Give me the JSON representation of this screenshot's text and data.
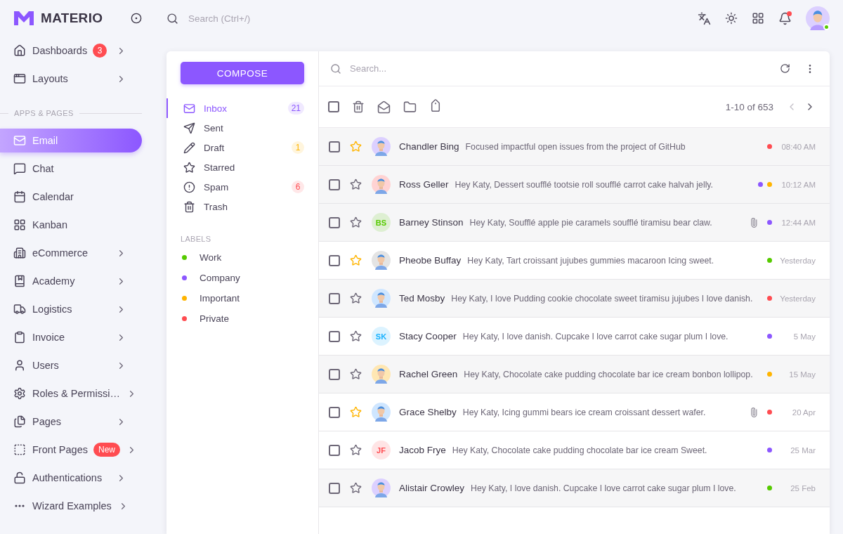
{
  "brand": {
    "name": "MATERIO"
  },
  "topbar": {
    "search": {
      "placeholder": "Search (Ctrl+/)"
    },
    "notifications": {
      "unread": true
    },
    "user": {
      "online": true
    }
  },
  "nav": [
    {
      "kind": "item",
      "label": "Dashboards",
      "badge": {
        "kind": "count",
        "text": "3"
      },
      "expandable": true,
      "selected": false
    },
    {
      "kind": "item",
      "label": "Layouts",
      "expandable": true,
      "selected": false
    },
    {
      "kind": "section",
      "label": "APPS & PAGES"
    },
    {
      "kind": "item",
      "label": "Email",
      "expandable": false,
      "selected": true
    },
    {
      "kind": "item",
      "label": "Chat",
      "expandable": false,
      "selected": false
    },
    {
      "kind": "item",
      "label": "Calendar",
      "expandable": false,
      "selected": false
    },
    {
      "kind": "item",
      "label": "Kanban",
      "expandable": false,
      "selected": false
    },
    {
      "kind": "item",
      "label": "eCommerce",
      "expandable": true,
      "selected": false
    },
    {
      "kind": "item",
      "label": "Academy",
      "expandable": true,
      "selected": false
    },
    {
      "kind": "item",
      "label": "Logistics",
      "expandable": true,
      "selected": false
    },
    {
      "kind": "item",
      "label": "Invoice",
      "expandable": true,
      "selected": false
    },
    {
      "kind": "item",
      "label": "Users",
      "expandable": true,
      "selected": false
    },
    {
      "kind": "item",
      "label": "Roles & Permissi…",
      "expandable": true,
      "selected": false
    },
    {
      "kind": "item",
      "label": "Pages",
      "expandable": true,
      "selected": false
    },
    {
      "kind": "item",
      "label": "Front Pages",
      "badge": {
        "kind": "pill",
        "text": "New"
      },
      "expandable": true,
      "selected": false
    },
    {
      "kind": "item",
      "label": "Authentications",
      "expandable": true,
      "selected": false
    },
    {
      "kind": "item",
      "label": "Wizard Examples",
      "expandable": true,
      "selected": false
    }
  ],
  "compose": {
    "label": "COMPOSE"
  },
  "folders": [
    {
      "label": "Inbox",
      "count": "21",
      "color": "#8c57ff",
      "selected": true
    },
    {
      "label": "Sent",
      "selected": false
    },
    {
      "label": "Draft",
      "count": "1",
      "color": "#ffb400",
      "selected": false
    },
    {
      "label": "Starred",
      "selected": false
    },
    {
      "label": "Spam",
      "count": "6",
      "color": "#ff4c51",
      "selected": false
    },
    {
      "label": "Trash",
      "selected": false
    }
  ],
  "labels_title": "LABELS",
  "labels": [
    {
      "label": "Work",
      "color": "#56ca00"
    },
    {
      "label": "Company",
      "color": "#8c57ff"
    },
    {
      "label": "Important",
      "color": "#ffb400"
    },
    {
      "label": "Private",
      "color": "#ff4c51"
    }
  ],
  "mail_search": {
    "placeholder": "Search..."
  },
  "toolbar": {
    "select_all": {
      "checked": false
    },
    "range": "1-10 of 653",
    "prev_disabled": true
  },
  "emails": [
    {
      "sender": "Chandler Bing",
      "message": "Focused impactful open issues from the project of GitHub",
      "time": "08:40 AM",
      "read": true,
      "starred": true,
      "checked": false,
      "attachment": false,
      "avatar": {
        "kind": "picture",
        "color": "#dcd0ff"
      },
      "labels": [
        {
          "color": "#ff4c51"
        }
      ]
    },
    {
      "sender": "Ross Geller",
      "message": "Hey Katy, Dessert soufflé tootsie roll soufflé carrot cake halvah jelly.",
      "time": "10:12 AM",
      "read": true,
      "starred": false,
      "checked": false,
      "attachment": false,
      "avatar": {
        "kind": "picture",
        "color": "#ffd3d3"
      },
      "labels": [
        {
          "color": "#8c57ff"
        },
        {
          "color": "#ffb400"
        }
      ]
    },
    {
      "sender": "Barney Stinson",
      "message": "Hey Katy, Soufflé apple pie caramels soufflé tiramisu bear claw.",
      "time": "12:44 AM",
      "read": true,
      "starred": false,
      "checked": false,
      "attachment": true,
      "avatar": {
        "kind": "initials",
        "initials": "BS",
        "color": "#56ca00"
      },
      "labels": [
        {
          "color": "#8c57ff"
        }
      ]
    },
    {
      "sender": "Pheobe Buffay",
      "message": "Hey Katy, Tart croissant jujubes gummies macaroon Icing sweet.",
      "time": "Yesterday",
      "read": false,
      "starred": true,
      "checked": false,
      "attachment": false,
      "avatar": {
        "kind": "picture",
        "color": "#e4e4e4"
      },
      "labels": [
        {
          "color": "#56ca00"
        }
      ]
    },
    {
      "sender": "Ted Mosby",
      "message": "Hey Katy, I love Pudding cookie chocolate sweet tiramisu jujubes I love danish.",
      "time": "Yesterday",
      "read": true,
      "starred": false,
      "checked": false,
      "attachment": false,
      "avatar": {
        "kind": "picture",
        "color": "#cfe6ff"
      },
      "labels": [
        {
          "color": "#ff4c51"
        }
      ]
    },
    {
      "sender": "Stacy Cooper",
      "message": "Hey Katy, I love danish. Cupcake I love carrot cake sugar plum I love.",
      "time": "5 May",
      "read": false,
      "starred": false,
      "checked": false,
      "attachment": false,
      "avatar": {
        "kind": "initials",
        "initials": "SK",
        "color": "#16b1ff"
      },
      "labels": [
        {
          "color": "#8c57ff"
        }
      ]
    },
    {
      "sender": "Rachel Green",
      "message": "Hey Katy, Chocolate cake pudding chocolate bar ice cream bonbon lollipop.",
      "time": "15 May",
      "read": true,
      "starred": false,
      "checked": false,
      "attachment": false,
      "avatar": {
        "kind": "picture",
        "color": "#ffe7b3"
      },
      "labels": [
        {
          "color": "#ffb400"
        }
      ]
    },
    {
      "sender": "Grace Shelby",
      "message": "Hey Katy, Icing gummi bears ice cream croissant dessert wafer.",
      "time": "20 Apr",
      "read": false,
      "starred": true,
      "checked": false,
      "attachment": true,
      "avatar": {
        "kind": "picture",
        "color": "#cfe6ff"
      },
      "labels": [
        {
          "color": "#ff4c51"
        }
      ]
    },
    {
      "sender": "Jacob Frye",
      "message": "Hey Katy, Chocolate cake pudding chocolate bar ice cream Sweet.",
      "time": "25 Mar",
      "read": false,
      "starred": false,
      "checked": false,
      "attachment": false,
      "avatar": {
        "kind": "initials",
        "initials": "JF",
        "color": "#ff4c51"
      },
      "labels": [
        {
          "color": "#8c57ff"
        }
      ]
    },
    {
      "sender": "Alistair Crowley",
      "message": "Hey Katy, I love danish. Cupcake I love carrot cake sugar plum I love.",
      "time": "25 Feb",
      "read": true,
      "starred": false,
      "checked": false,
      "attachment": false,
      "avatar": {
        "kind": "picture",
        "color": "#dcd0ff"
      },
      "labels": [
        {
          "color": "#56ca00"
        }
      ]
    }
  ]
}
